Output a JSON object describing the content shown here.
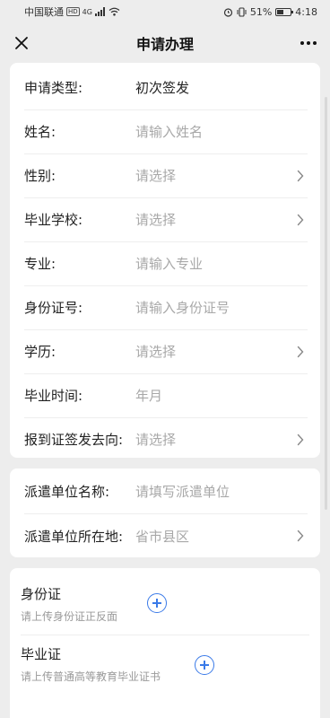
{
  "status_bar": {
    "carrier": "中国联通",
    "hd": "HD",
    "network": "4G",
    "battery_percent": "51%",
    "battery_level": 0.51,
    "time": "4:18"
  },
  "nav": {
    "title": "申请办理",
    "close_icon": "close-icon",
    "more_icon": "more-icon"
  },
  "form": {
    "rows": [
      {
        "label": "申请类型:",
        "value": "初次签发",
        "filled": true,
        "chevron": false
      },
      {
        "label": "姓名:",
        "value": "请输入姓名",
        "filled": false,
        "chevron": false
      },
      {
        "label": "性别:",
        "value": "请选择",
        "filled": false,
        "chevron": true
      },
      {
        "label": "毕业学校:",
        "value": "请选择",
        "filled": false,
        "chevron": true
      },
      {
        "label": "专业:",
        "value": "请输入专业",
        "filled": false,
        "chevron": false
      },
      {
        "label": "身份证号:",
        "value": "请输入身份证号",
        "filled": false,
        "chevron": false
      },
      {
        "label": "学历:",
        "value": "请选择",
        "filled": false,
        "chevron": true
      },
      {
        "label": "毕业时间:",
        "value": "年月",
        "filled": false,
        "chevron": false
      },
      {
        "label": "报到证签发去向:",
        "value": "请选择",
        "filled": false,
        "chevron": true
      }
    ]
  },
  "dispatch": {
    "rows": [
      {
        "label": "派遣单位名称:",
        "value": "请填写派遣单位",
        "chevron": false
      },
      {
        "label": "派遣单位所在地:",
        "value": "省市县区",
        "chevron": true
      }
    ]
  },
  "uploads": [
    {
      "title": "身份证",
      "hint": "请上传身份证正反面"
    },
    {
      "title": "毕业证",
      "hint": "请上传普通高等教育毕业证书"
    }
  ],
  "colors": {
    "accent": "#3a7ae8",
    "placeholder": "#a8a8a8",
    "background": "#ededed"
  }
}
